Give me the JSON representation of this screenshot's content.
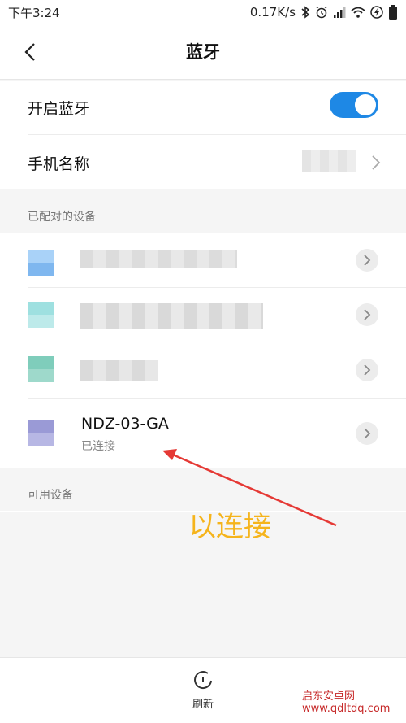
{
  "status_bar": {
    "time": "下午3:24",
    "speed": "0.17K/s"
  },
  "header": {
    "title": "蓝牙"
  },
  "settings": {
    "enable_bluetooth_label": "开启蓝牙",
    "enable_bluetooth_on": true,
    "phone_name_label": "手机名称"
  },
  "paired": {
    "header": "已配对的设备",
    "devices": [
      {
        "name": "",
        "status": "",
        "icon_color": "#8ec3f5"
      },
      {
        "name": "",
        "status": "",
        "icon_color": "#8fd6d6"
      },
      {
        "name": "",
        "status": "",
        "icon_color": "#6fc0b0"
      },
      {
        "name": "NDZ-03-GA",
        "status": "已连接",
        "icon_color": "#9a9ad6"
      }
    ]
  },
  "available": {
    "header": "可用设备"
  },
  "annotation": {
    "text": "以连接",
    "color": "#f5b41c"
  },
  "bottom": {
    "refresh_label": "刷新",
    "watermark": "启东安卓网 www.qdltdq.com"
  },
  "colors": {
    "accent": "#1e88e5",
    "arrow": "#e53935"
  }
}
